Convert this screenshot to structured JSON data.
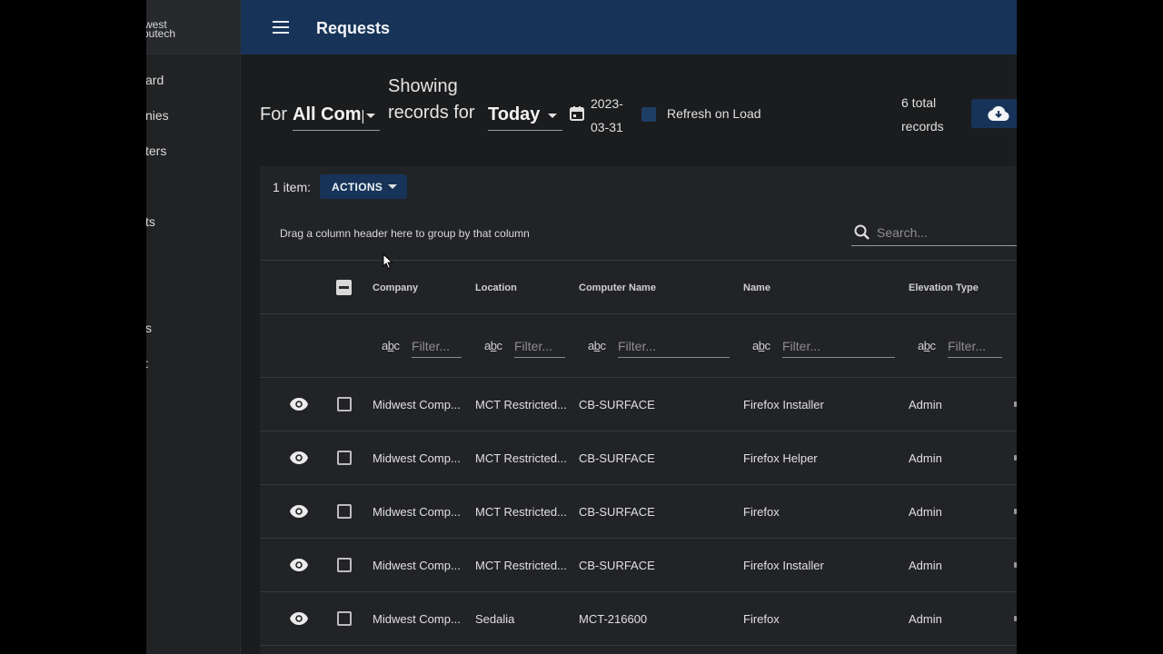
{
  "brand": {
    "line1": "west",
    "line2": "putech"
  },
  "sidebar": {
    "items": [
      {
        "label": "ard"
      },
      {
        "label": "nies"
      },
      {
        "label": "ters"
      },
      {
        "label": "ts"
      },
      {
        "label": "s"
      },
      {
        "label": ":"
      }
    ]
  },
  "header": {
    "title": "Requests"
  },
  "controls": {
    "for_label": "For",
    "company_value": "All Companies",
    "showing_text": "Showing records for",
    "range_value": "Today",
    "date_line1": "2023-",
    "date_line2": "03-31",
    "refresh_label": "Refresh on Load",
    "refresh_checked": true,
    "total_line1": "6 total",
    "total_line2": "records"
  },
  "grid": {
    "selection_count": "1 item:",
    "actions_label": "ACTIONS",
    "group_hint": "Drag a column header here to group by that column",
    "search_placeholder": "Search...",
    "filter_placeholder": "Filter...",
    "columns": [
      "Company",
      "Location",
      "Computer Name",
      "Name",
      "Elevation Type"
    ],
    "rows": [
      {
        "company": "Midwest Comp...",
        "location": "MCT Restricted...",
        "computer": "CB-SURFACE",
        "name": "Firefox Installer",
        "elevation": "Admin"
      },
      {
        "company": "Midwest Comp...",
        "location": "MCT Restricted...",
        "computer": "CB-SURFACE",
        "name": "Firefox Helper",
        "elevation": "Admin"
      },
      {
        "company": "Midwest Comp...",
        "location": "MCT Restricted...",
        "computer": "CB-SURFACE",
        "name": "Firefox",
        "elevation": "Admin"
      },
      {
        "company": "Midwest Comp...",
        "location": "MCT Restricted...",
        "computer": "CB-SURFACE",
        "name": "Firefox Installer",
        "elevation": "Admin"
      },
      {
        "company": "Midwest Comp...",
        "location": "Sedalia",
        "computer": "MCT-216600",
        "name": "Firefox",
        "elevation": "Admin"
      }
    ]
  },
  "colors": {
    "primary": "#173458",
    "background": "#1b1c1e",
    "panel": "#222326"
  },
  "icons": [
    "menu-icon",
    "calendar-icon",
    "cloud-download-icon",
    "search-icon",
    "eye-icon",
    "abc-filter-icon",
    "mouse-cursor-icon"
  ]
}
